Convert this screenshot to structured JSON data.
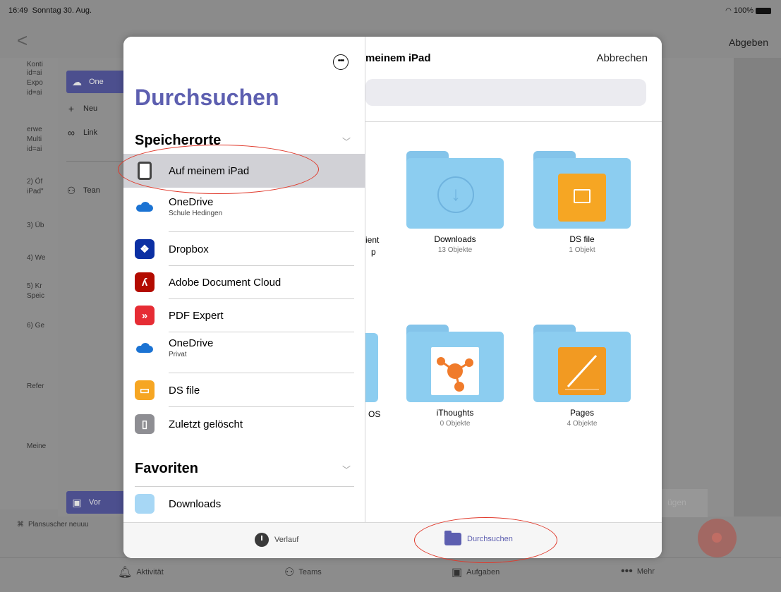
{
  "status_bar": {
    "time": "16:49",
    "date": "Sonntag 30. Aug.",
    "battery": "100%"
  },
  "top_nav": {
    "back": "<",
    "submit": "Abgeben"
  },
  "bg_left_text": [
    "Konti",
    "id=ai",
    "Expo",
    "id=ai",
    "erwe",
    "Multi",
    "id=ai",
    "2) Öf",
    "iPad\"",
    "3) Üb",
    "4) We",
    "5) Kr",
    "Speic",
    "6) Ge",
    "Refer",
    "Meine"
  ],
  "bg_popup_menu": {
    "items": [
      "One",
      "Neu",
      "Link",
      "Tean"
    ],
    "bottom": "Vor"
  },
  "bg_plan_row": "Plansuscher neuuu",
  "bg_fuegen": "ügen",
  "bg_tabbar": {
    "activity": "Aktivität",
    "teams": "Teams",
    "assignments": "Aufgaben",
    "more": "Mehr"
  },
  "sidebar": {
    "title": "Durchsuchen",
    "section_locations": "Speicherorte",
    "section_favorites": "Favoriten",
    "locations": [
      {
        "label": "Auf meinem iPad",
        "sub": "",
        "icon": "ipad-icon"
      },
      {
        "label": "OneDrive",
        "sub": "Schule Hedingen",
        "icon": "onedrive-icon"
      },
      {
        "label": "Dropbox",
        "sub": "",
        "icon": "dropbox-icon"
      },
      {
        "label": "Adobe Document Cloud",
        "sub": "",
        "icon": "adobe-icon"
      },
      {
        "label": "PDF Expert",
        "sub": "",
        "icon": "pdf-expert-icon"
      },
      {
        "label": "OneDrive",
        "sub": "Privat",
        "icon": "onedrive-icon"
      },
      {
        "label": "DS file",
        "sub": "",
        "icon": "ds-file-icon"
      },
      {
        "label": "Zuletzt gelöscht",
        "sub": "",
        "icon": "trash-icon"
      }
    ],
    "favorites": [
      {
        "label": "Downloads",
        "icon": "folder-icon"
      }
    ]
  },
  "content": {
    "title": "meinem iPad",
    "cancel": "Abbrechen",
    "partials": [
      "ient",
      "p",
      "OS"
    ],
    "folders": [
      {
        "name": "Downloads",
        "count": "13 Objekte",
        "icon": "download-folder-icon"
      },
      {
        "name": "DS file",
        "count": "1 Objekt",
        "icon": "ds-file-folder-icon"
      },
      {
        "name": "iThoughts",
        "count": "0 Objekte",
        "icon": "ithoughts-folder-icon"
      },
      {
        "name": "Pages",
        "count": "4 Objekte",
        "icon": "pages-folder-icon"
      }
    ]
  },
  "modal_tabs": {
    "recents": "Verlauf",
    "browse": "Durchsuchen"
  },
  "colors": {
    "accent": "#5d5fb0",
    "annotation": "#e0392b",
    "selected_row": "#d1d1d6"
  }
}
